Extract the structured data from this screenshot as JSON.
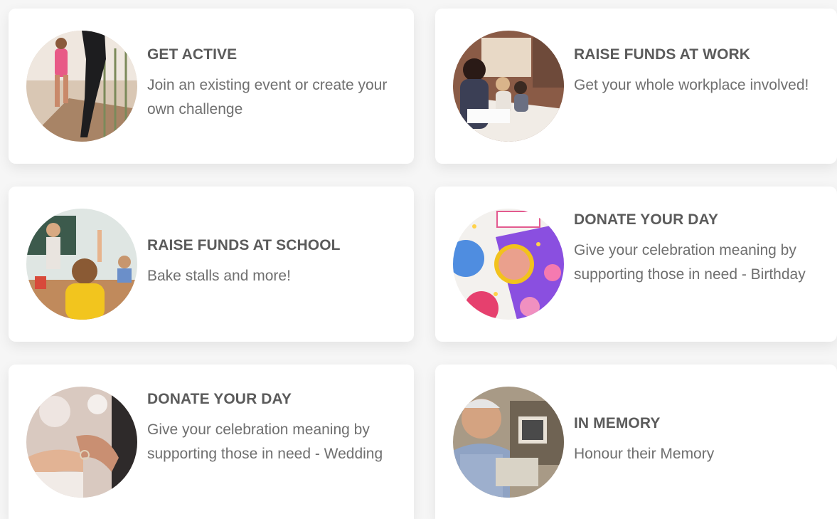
{
  "cards": [
    {
      "title": "GET ACTIVE",
      "description": "Join an existing event or create your own challenge",
      "image": "running-photo"
    },
    {
      "title": "RAISE FUNDS AT WORK",
      "description": "Get your whole workplace involved!",
      "image": "office-meeting-photo"
    },
    {
      "title": "RAISE FUNDS AT SCHOOL",
      "description": "Bake stalls and more!",
      "image": "classroom-photo"
    },
    {
      "title": "DONATE YOUR DAY",
      "description": "Give your celebration meaning by supporting those in need - Birthday",
      "image": "birthday-party-photo"
    },
    {
      "title": "DONATE YOUR DAY",
      "description": "Give your celebration meaning by supporting those in need - Wedding",
      "image": "wedding-rings-photo"
    },
    {
      "title": "IN MEMORY",
      "description": "Honour their Memory",
      "image": "elderly-man-photo"
    }
  ],
  "colors": {
    "background": "#f6f6f6",
    "card": "#ffffff",
    "title": "#5b5b5b",
    "description": "#6f6f6f"
  }
}
